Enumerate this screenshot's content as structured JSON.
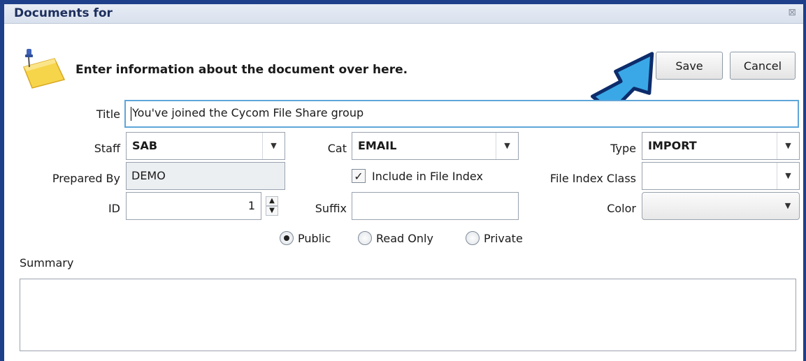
{
  "window": {
    "title": "Documents for",
    "close_glyph": "⊠"
  },
  "header": {
    "icon": "pushpin-note-icon",
    "text": "Enter information about the document over here.",
    "save_label": "Save",
    "cancel_label": "Cancel"
  },
  "form": {
    "title_label": "Title",
    "title_value": "You've joined the Cycom File Share group",
    "staff_label": "Staff",
    "staff_value": "SAB",
    "cat_label": "Cat",
    "cat_value": "EMAIL",
    "type_label": "Type",
    "type_value": "IMPORT",
    "prepared_by_label": "Prepared By",
    "prepared_by_value": "DEMO",
    "include_index_label": "Include in File Index",
    "include_index_checked": true,
    "file_index_class_label": "File Index Class",
    "file_index_class_value": "",
    "id_label": "ID",
    "id_value": "1",
    "suffix_label": "Suffix",
    "suffix_value": "",
    "color_label": "Color",
    "color_value": "",
    "visibility_options": [
      "Public",
      "Read Only",
      "Private"
    ],
    "visibility_selected": "Public",
    "summary_label": "Summary",
    "summary_value": ""
  },
  "colors": {
    "window_border": "#1e3f8a",
    "title_text": "#1d2f5e",
    "focus_border": "#5fa6d9",
    "annotation_arrow": "#3aa8e6"
  }
}
